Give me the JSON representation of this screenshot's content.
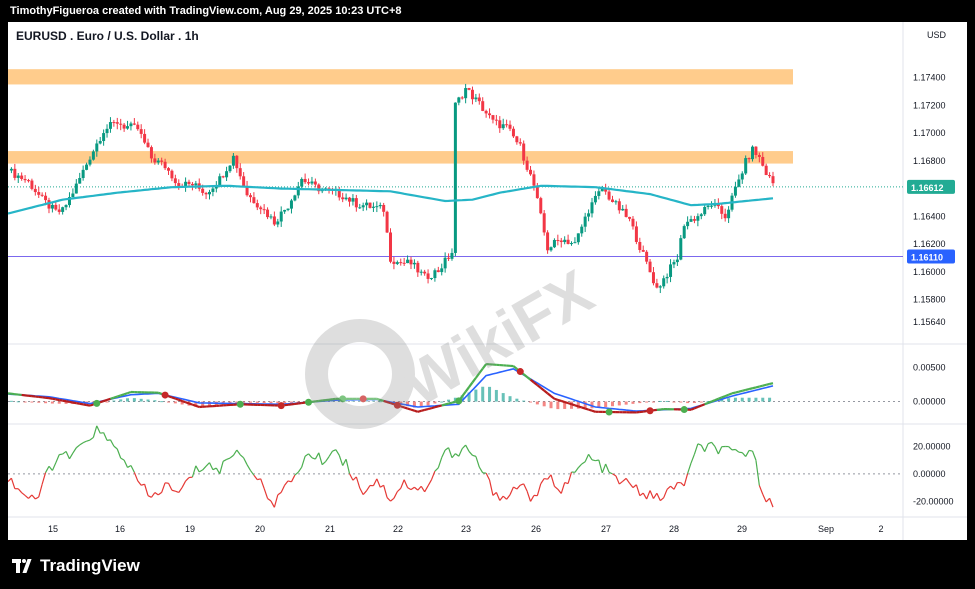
{
  "header": {
    "caption": "TimothyFigueroa created with TradingView.com, Aug 29, 2025 10:23 UTC+8"
  },
  "footer": {
    "brand": "TradingView"
  },
  "watermark": {
    "text": "WikiFX"
  },
  "colors": {
    "up": "#089981",
    "down": "#f23645",
    "ma": "#26b5c7",
    "zone": "#ffcc8c",
    "price_tag": "#22ab94",
    "level_tag": "#2962ff"
  },
  "chart_data": {
    "type": "candlestick",
    "title": "EURUSD . Euro / U.S. Dollar . 1h",
    "currency": "USD",
    "price_axis": {
      "range": [
        1.1548,
        1.178
      ],
      "ticks": [
        "1.17400",
        "1.17200",
        "1.17000",
        "1.16800",
        "1.16400",
        "1.16200",
        "1.16000",
        "1.15800",
        "1.15640"
      ]
    },
    "last_price": {
      "label": "1.16612",
      "value": 1.16612
    },
    "horizontal_line": {
      "label": "1.16110",
      "value": 1.1611
    },
    "resistance_zones": [
      {
        "from": 1.1735,
        "to": 1.1746
      },
      {
        "from": 1.1678,
        "to": 1.1687
      }
    ],
    "x_axis": {
      "ticks": [
        "15",
        "16",
        "19",
        "20",
        "21",
        "22",
        "23",
        "26",
        "27",
        "28",
        "29",
        "Sep",
        "2"
      ]
    },
    "price_path": [
      [
        0,
        1.1673
      ],
      [
        3,
        1.1665
      ],
      [
        5,
        1.1652
      ],
      [
        7,
        1.1643
      ],
      [
        8,
        1.1644
      ],
      [
        10,
        1.1662
      ],
      [
        12,
        1.1683
      ],
      [
        14,
        1.1702
      ],
      [
        16,
        1.1708
      ],
      [
        17,
        1.1705
      ],
      [
        19,
        1.1703
      ],
      [
        21,
        1.1682
      ],
      [
        23,
        1.1676
      ],
      [
        25,
        1.1663
      ],
      [
        27,
        1.1663
      ],
      [
        29,
        1.1657
      ],
      [
        31,
        1.1667
      ],
      [
        33,
        1.1683
      ],
      [
        35,
        1.1656
      ],
      [
        37,
        1.1647
      ],
      [
        39,
        1.1636
      ],
      [
        41,
        1.1648
      ],
      [
        43,
        1.1667
      ],
      [
        45,
        1.1661
      ],
      [
        47,
        1.1658
      ],
      [
        49,
        1.1655
      ],
      [
        51,
        1.1649
      ],
      [
        53,
        1.1647
      ],
      [
        55,
        1.1645
      ],
      [
        56,
        1.161
      ],
      [
        57,
        1.1607
      ],
      [
        59,
        1.1606
      ],
      [
        61,
        1.1596
      ],
      [
        63,
        1.1601
      ],
      [
        65,
        1.1614
      ],
      [
        65.5,
        1.172
      ],
      [
        67,
        1.1732
      ],
      [
        69,
        1.1721
      ],
      [
        71,
        1.1708
      ],
      [
        73,
        1.1704
      ],
      [
        75,
        1.169
      ],
      [
        77,
        1.1662
      ],
      [
        79,
        1.1617
      ],
      [
        81,
        1.1624
      ],
      [
        83,
        1.162
      ],
      [
        85,
        1.1645
      ],
      [
        87,
        1.166
      ],
      [
        89,
        1.1648
      ],
      [
        91,
        1.1637
      ],
      [
        93,
        1.1612
      ],
      [
        95,
        1.1588
      ],
      [
        96,
        1.1595
      ],
      [
        98,
        1.161
      ],
      [
        99,
        1.1635
      ],
      [
        101,
        1.164
      ],
      [
        103,
        1.1649
      ],
      [
        105,
        1.164
      ],
      [
        107,
        1.1666
      ],
      [
        108,
        1.1679
      ],
      [
        109,
        1.1688
      ],
      [
        110,
        1.1682
      ],
      [
        111,
        1.1671
      ],
      [
        112,
        1.1664
      ]
    ],
    "ma_path": [
      [
        0,
        1.1642
      ],
      [
        8,
        1.1652
      ],
      [
        16,
        1.1657
      ],
      [
        24,
        1.1661
      ],
      [
        32,
        1.1662
      ],
      [
        40,
        1.166
      ],
      [
        48,
        1.1659
      ],
      [
        56,
        1.1658
      ],
      [
        64,
        1.1651
      ],
      [
        68,
        1.1652
      ],
      [
        72,
        1.1657
      ],
      [
        78,
        1.1662
      ],
      [
        86,
        1.1661
      ],
      [
        94,
        1.1656
      ],
      [
        100,
        1.1648
      ],
      [
        104,
        1.1649
      ],
      [
        110,
        1.1652
      ],
      [
        112,
        1.1653
      ]
    ],
    "oscillator_1": {
      "ticks": [
        "0.00500",
        "0.00000"
      ],
      "range": [
        -0.003,
        0.008
      ],
      "fast": [
        [
          0,
          0.0012
        ],
        [
          6,
          0.0005
        ],
        [
          12,
          -0.0006
        ],
        [
          18,
          0.0014
        ],
        [
          22,
          0.0013
        ],
        [
          28,
          -0.0008
        ],
        [
          34,
          -0.0004
        ],
        [
          40,
          -0.0006
        ],
        [
          48,
          0.0004
        ],
        [
          54,
          0.0004
        ],
        [
          60,
          -0.0015
        ],
        [
          66,
          0.0001
        ],
        [
          70,
          0.0055
        ],
        [
          74,
          0.0052
        ],
        [
          80,
          0.0004
        ],
        [
          86,
          -0.0015
        ],
        [
          92,
          -0.0016
        ],
        [
          96,
          -0.0011
        ],
        [
          100,
          -0.0012
        ],
        [
          106,
          0.0012
        ],
        [
          112,
          0.0027
        ]
      ],
      "slow": [
        [
          0,
          0.0011
        ],
        [
          6,
          0.0007
        ],
        [
          12,
          -0.0003
        ],
        [
          18,
          0.001
        ],
        [
          22,
          0.0012
        ],
        [
          28,
          -0.0002
        ],
        [
          34,
          -0.0003
        ],
        [
          40,
          -0.0004
        ],
        [
          48,
          0.0002
        ],
        [
          54,
          0.0003
        ],
        [
          60,
          -0.0008
        ],
        [
          66,
          -0.0004
        ],
        [
          70,
          0.0038
        ],
        [
          74,
          0.0048
        ],
        [
          80,
          0.0012
        ],
        [
          86,
          -0.0008
        ],
        [
          92,
          -0.0014
        ],
        [
          96,
          -0.0012
        ],
        [
          100,
          -0.001
        ],
        [
          106,
          0.0008
        ],
        [
          112,
          0.0023
        ]
      ],
      "cross_up": [
        13,
        34,
        44,
        49,
        66,
        88,
        99
      ],
      "cross_down": [
        23,
        40,
        52,
        57,
        75,
        94
      ]
    },
    "oscillator_2": {
      "ticks": [
        "20.00000",
        "0.00000",
        "-20.00000"
      ],
      "range": [
        -30,
        35
      ],
      "values": [
        [
          0,
          -3
        ],
        [
          2,
          -13
        ],
        [
          4,
          -22
        ],
        [
          6,
          5
        ],
        [
          8,
          12
        ],
        [
          10,
          15
        ],
        [
          12,
          28
        ],
        [
          13,
          32
        ],
        [
          15,
          22
        ],
        [
          17,
          12
        ],
        [
          19,
          -6
        ],
        [
          21,
          -18
        ],
        [
          23,
          -8
        ],
        [
          25,
          -15
        ],
        [
          27,
          0
        ],
        [
          29,
          8
        ],
        [
          31,
          2
        ],
        [
          33,
          17
        ],
        [
          35,
          10
        ],
        [
          37,
          -8
        ],
        [
          39,
          -20
        ],
        [
          41,
          -9
        ],
        [
          43,
          8
        ],
        [
          44,
          14
        ],
        [
          46,
          10
        ],
        [
          48,
          18
        ],
        [
          50,
          3
        ],
        [
          52,
          -12
        ],
        [
          54,
          -4
        ],
        [
          56,
          -18
        ],
        [
          58,
          -6
        ],
        [
          60,
          -14
        ],
        [
          62,
          -4
        ],
        [
          64,
          17
        ],
        [
          66,
          12
        ],
        [
          67,
          20
        ],
        [
          69,
          6
        ],
        [
          71,
          -12
        ],
        [
          73,
          -18
        ],
        [
          75,
          -6
        ],
        [
          77,
          -20
        ],
        [
          79,
          -2
        ],
        [
          81,
          -10
        ],
        [
          83,
          0
        ],
        [
          85,
          12
        ],
        [
          87,
          5
        ],
        [
          89,
          -4
        ],
        [
          91,
          -8
        ],
        [
          93,
          -14
        ],
        [
          95,
          -18
        ],
        [
          97,
          -12
        ],
        [
          99,
          -6
        ],
        [
          101,
          18
        ],
        [
          103,
          20
        ],
        [
          105,
          16
        ],
        [
          107,
          14
        ],
        [
          109,
          18
        ],
        [
          110,
          -6
        ],
        [
          111,
          -16
        ],
        [
          112,
          -20
        ]
      ]
    }
  }
}
